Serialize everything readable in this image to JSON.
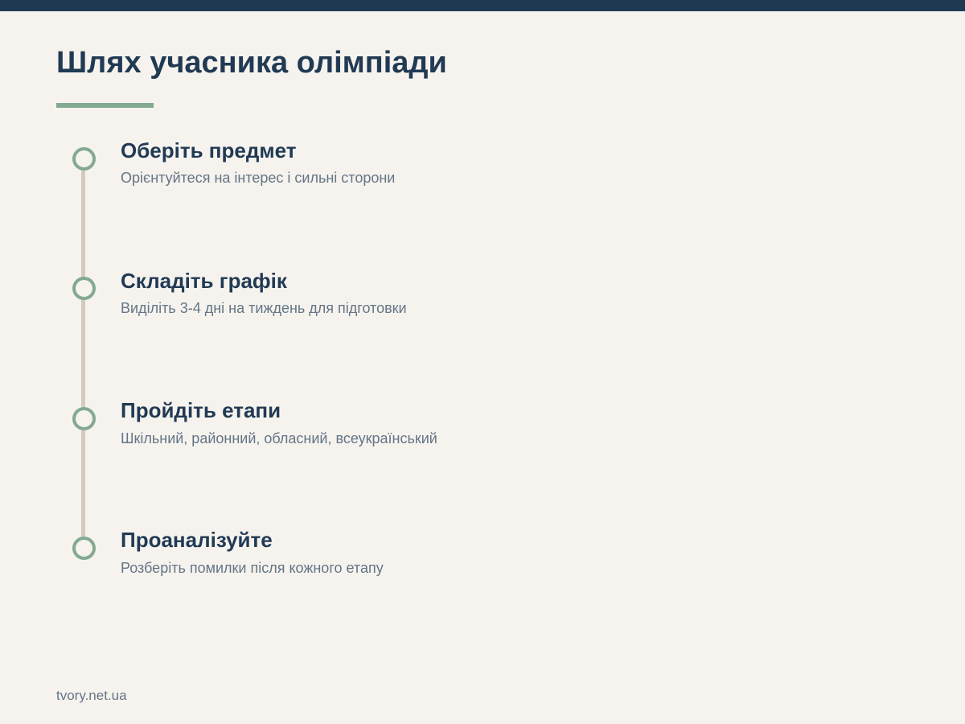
{
  "title": "Шлях учасника олімпіади",
  "steps": [
    {
      "title": "Оберіть предмет",
      "description": "Орієнтуйтеся на інтерес і сильні сторони"
    },
    {
      "title": "Складіть графік",
      "description": "Виділіть 3-4 дні на тиждень для підготовки"
    },
    {
      "title": "Пройдіть етапи",
      "description": "Шкільний, районний, обласний, всеукраїнський"
    },
    {
      "title": "Проаналізуйте",
      "description": "Розберіть помилки після кожного етапу"
    }
  ],
  "footer": {
    "source": "tvory.net.ua"
  },
  "colors": {
    "primary": "#213a54",
    "accent": "#84a991",
    "timeline": "#d3cbbe",
    "muted_text": "#647587",
    "background": "#f6f3ee"
  }
}
